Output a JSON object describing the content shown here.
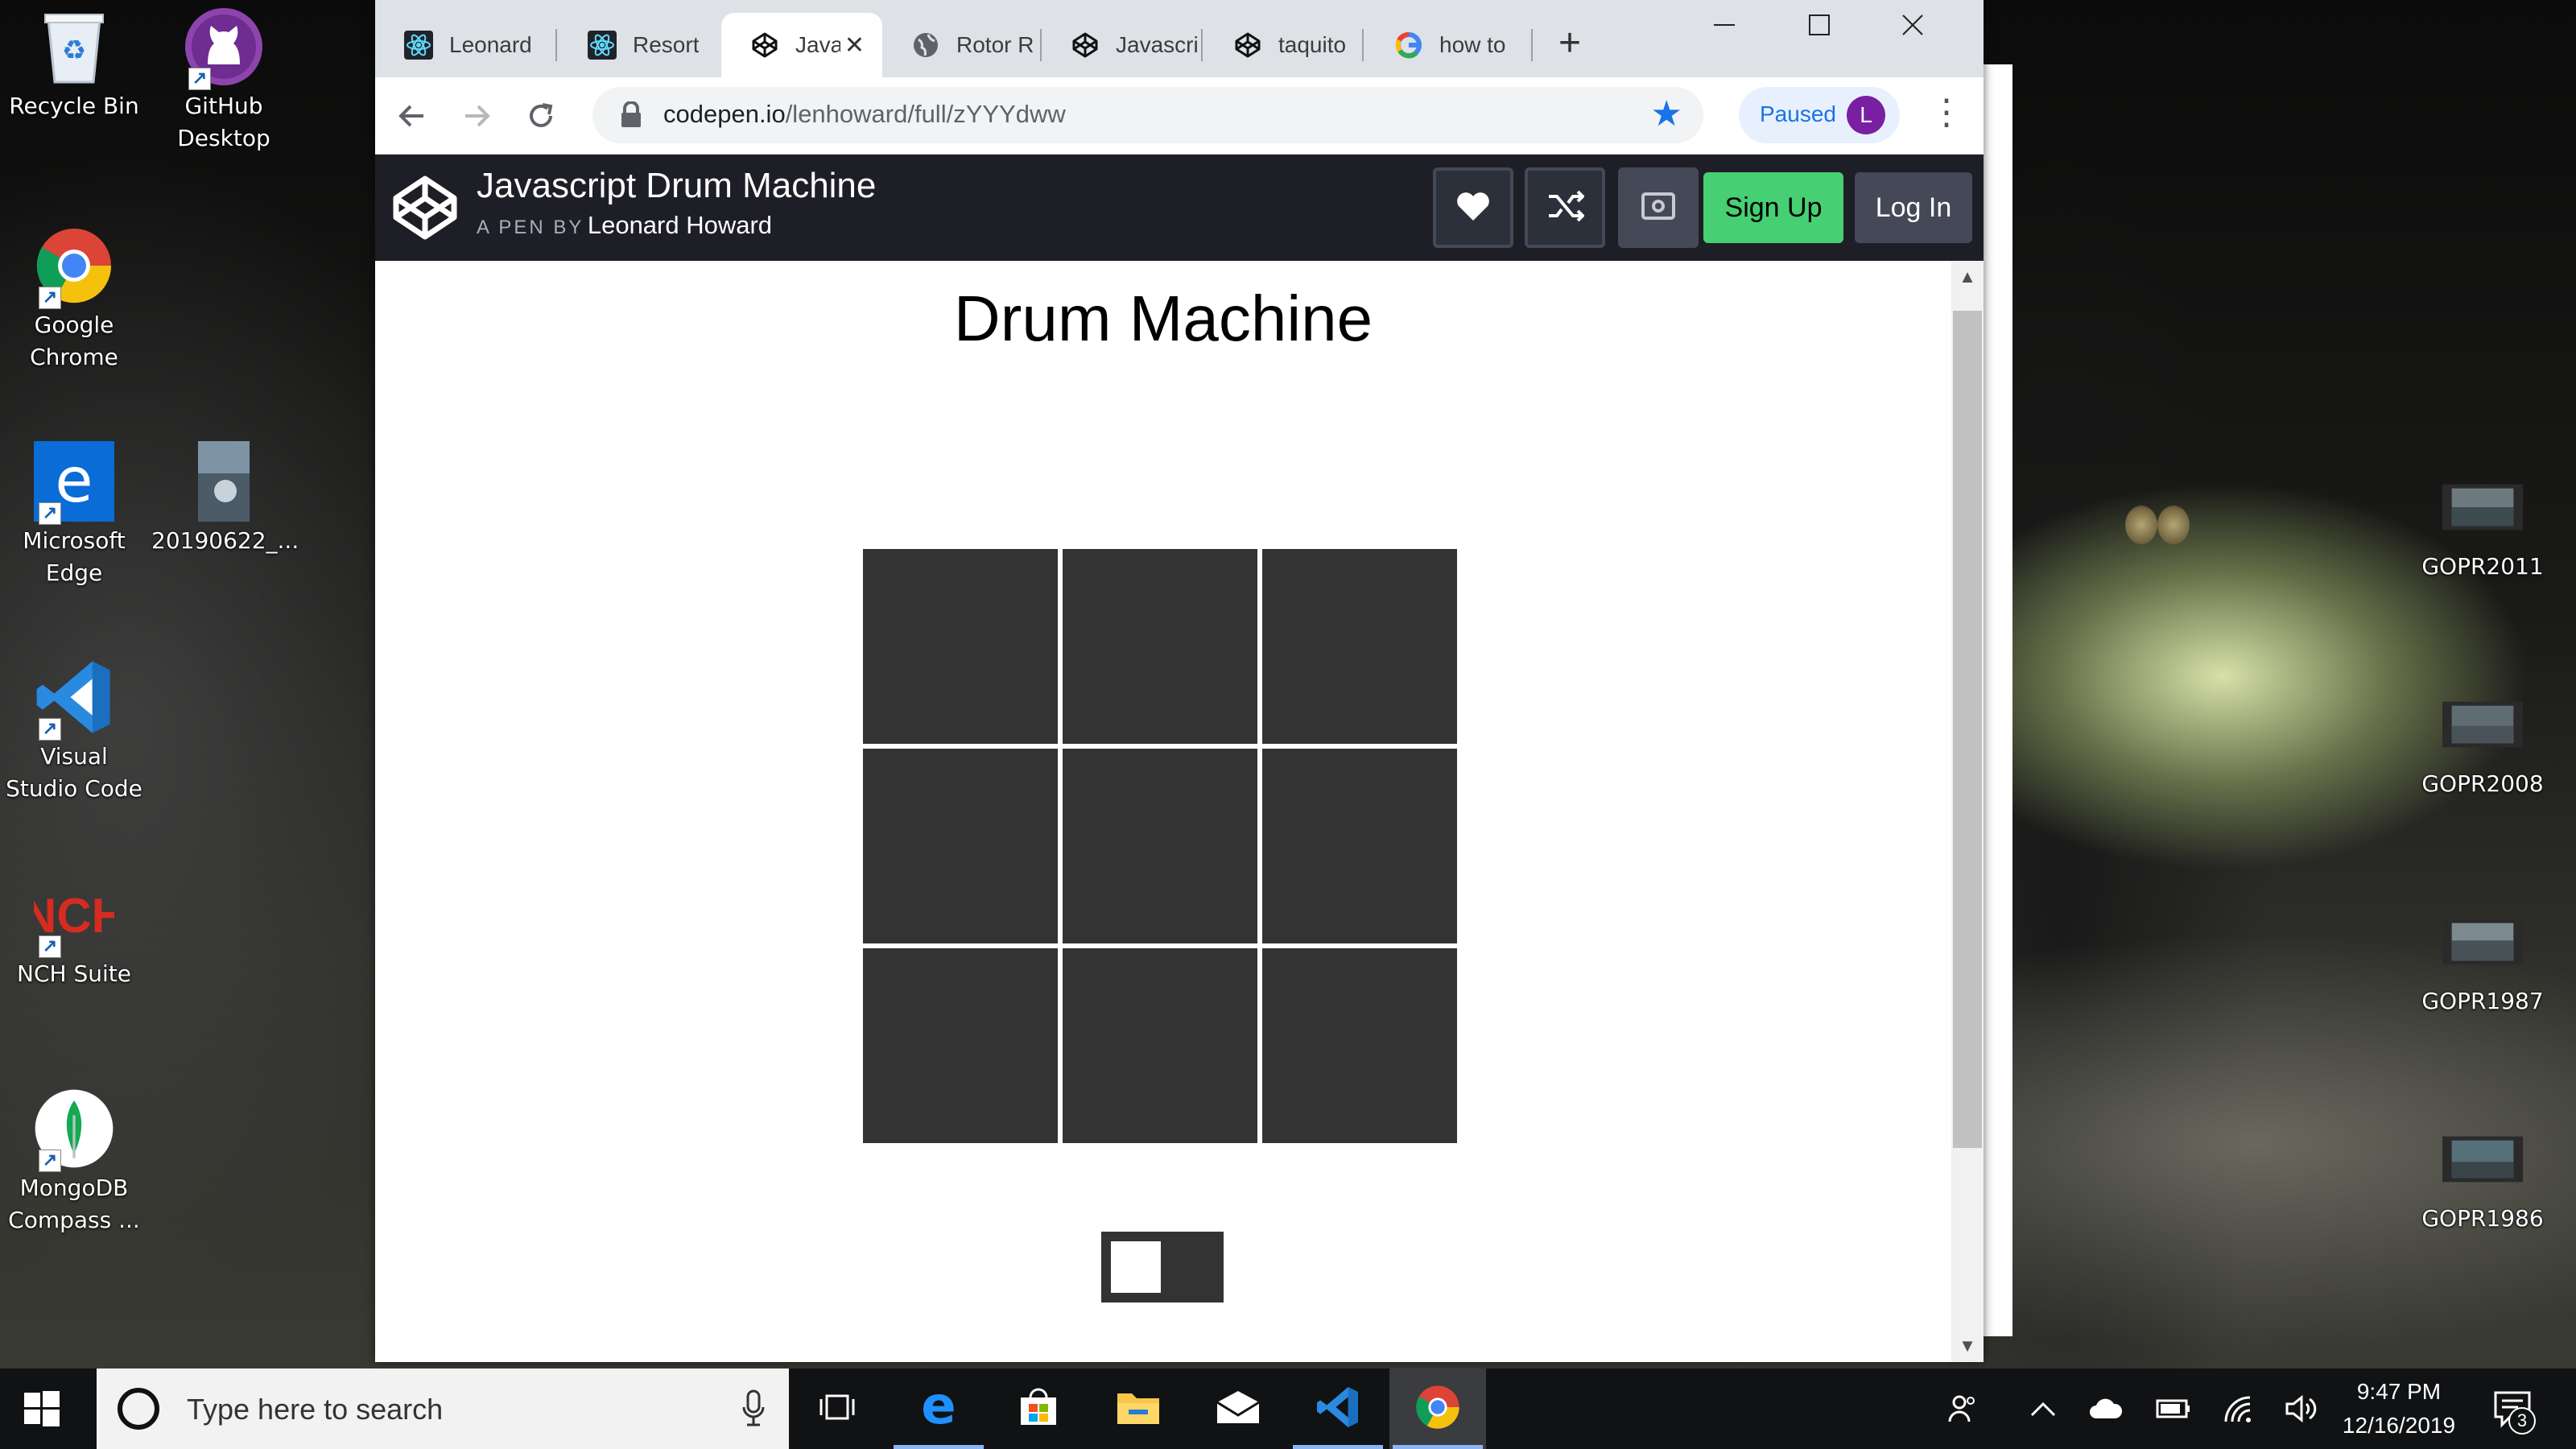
{
  "desktop": {
    "left_icons": [
      {
        "label": "Recycle Bin",
        "icon": "recycle-bin-icon"
      },
      {
        "label": "GitHub Desktop",
        "icon": "github-desktop-icon"
      },
      {
        "label": "Google Chrome",
        "icon": "chrome-icon"
      },
      {
        "label": "Microsoft Edge",
        "icon": "edge-icon"
      },
      {
        "label": "20190622_...",
        "icon": "image-file-icon"
      },
      {
        "label": "Visual Studio Code",
        "icon": "vscode-icon"
      },
      {
        "label": "NCH Suite",
        "icon": "nch-suite-icon"
      },
      {
        "label": "MongoDB Compass ...",
        "icon": "mongodb-compass-icon"
      }
    ],
    "right_icons": [
      {
        "label": "GOPR2011",
        "icon": "video-file-icon"
      },
      {
        "label": "GOPR2008",
        "icon": "video-file-icon"
      },
      {
        "label": "GOPR1987",
        "icon": "video-file-icon"
      },
      {
        "label": "GOPR1986",
        "icon": "video-file-icon"
      }
    ]
  },
  "browser": {
    "tabs": [
      {
        "title": "Leonard",
        "icon": "react-icon"
      },
      {
        "title": "Resort",
        "icon": "react-icon"
      },
      {
        "title": "Java",
        "icon": "codepen-icon",
        "active": true
      },
      {
        "title": "Rotor R",
        "icon": "globe-icon"
      },
      {
        "title": "Javascri",
        "icon": "codepen-icon"
      },
      {
        "title": "taquito",
        "icon": "codepen-icon"
      },
      {
        "title": "how to",
        "icon": "google-icon"
      }
    ],
    "new_tab_glyph": "+",
    "url_host": "codepen.io",
    "url_path": "/lenhoward/full/zYYYdww",
    "profile_status": "Paused",
    "profile_initial": "L"
  },
  "codepen": {
    "pen_title": "Javascript Drum Machine",
    "byline_prefix": "A PEN BY",
    "author": "Leonard Howard",
    "signup_label": "Sign Up",
    "login_label": "Log In"
  },
  "page": {
    "title": "Drum Machine",
    "pad_count": 9,
    "power_on": false
  },
  "taskbar": {
    "search_placeholder": "Type here to search",
    "time": "9:47 PM",
    "date": "12/16/2019",
    "notification_count": "3",
    "apps": [
      "task-view",
      "edge",
      "store",
      "file-explorer",
      "mail",
      "vscode",
      "chrome"
    ]
  },
  "colors": {
    "codepen_header": "#1e1f26",
    "signup_green": "#47cf73",
    "pad_dark": "#333333",
    "chrome_blue": "#1a73e8"
  }
}
